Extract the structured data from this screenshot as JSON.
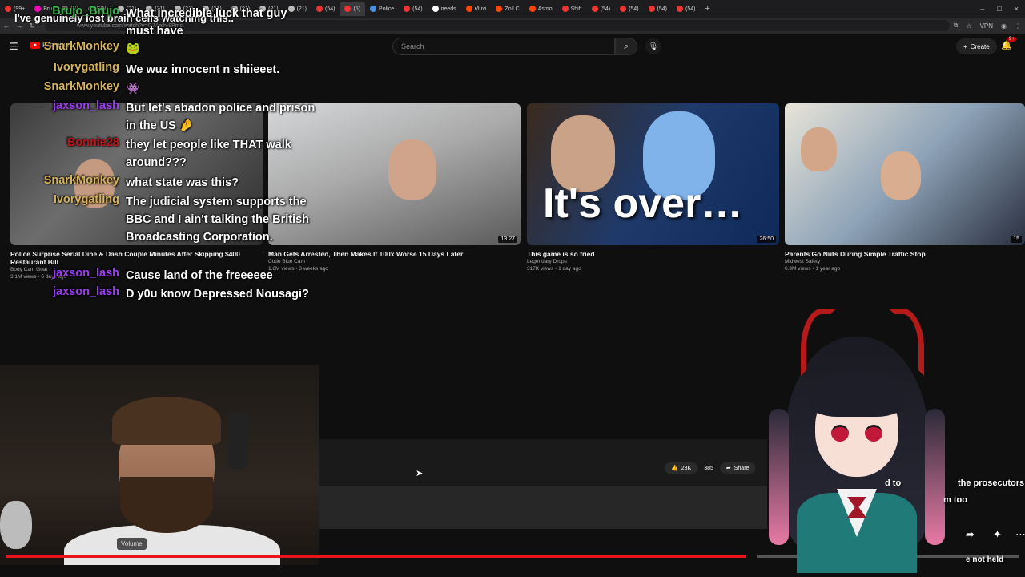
{
  "browser": {
    "tabs": [
      "(99+",
      "Bru",
      "(N)",
      "F(N)",
      "(21)",
      "(21)",
      "(21)",
      "(21)",
      "(21)",
      "(21)",
      "(21)",
      "(54)",
      "(5)",
      "Police",
      "(54)",
      "needs",
      "r/Livi",
      "Zoil C",
      "Asmo",
      "Shift",
      "(54)",
      "(54)",
      "(54)",
      "(54)"
    ],
    "url": "www.youtube.com/watch?v=G7Aalh-9Pmc",
    "vpn_label": "VPN"
  },
  "youtube": {
    "logo_text": "Premium",
    "search_placeholder": "Search",
    "create_label": "Create",
    "notif_count": "9+"
  },
  "videos": [
    {
      "title": "Police Surprise Serial Dine & Dash Couple Minutes After Skipping $400 Restaurant Bill",
      "channel": "Body Cam Goat",
      "meta": "3.1M views • 6 days ago",
      "duration": ""
    },
    {
      "title": "Man Gets Arrested, Then Makes It 100x Worse 15 Days Later",
      "channel": "Code Blue Cam",
      "meta": "1.6M views • 3 weeks ago",
      "duration": "13:27"
    },
    {
      "title": "This game is so fried",
      "channel": "Legendary Drops",
      "meta": "317K views • 1 day ago",
      "duration": "26:50",
      "overlay_text": "It's over…"
    },
    {
      "title": "Parents Go Nuts During Simple Traffic Stop",
      "channel": "Midwest Safety",
      "meta": "6.9M views • 1 year ago",
      "duration": "15"
    }
  ],
  "chat": [
    {
      "user": "",
      "msg": "I've genuinely lost brain cells watching this..",
      "color": "#ffffff"
    },
    {
      "user": "Brujo_Brujo",
      "msg": "What incredible luck that guy must have",
      "color": "#3cb44b"
    },
    {
      "user": "SnarkMonkey",
      "msg": "🐸",
      "color": "#d6b35c"
    },
    {
      "user": "Ivorygatling",
      "msg": "We wuz innocent n shiieeet.",
      "color": "#d6b35c"
    },
    {
      "user": "SnarkMonkey",
      "msg": "👾",
      "color": "#d6b35c"
    },
    {
      "user": "jaxson_lash",
      "msg": "But let's abadon police and prison in the US 🤌",
      "color": "#9b3cf0"
    },
    {
      "user": "Bonnie28",
      "msg": "they let people like THAT walk around???",
      "color": "#c0141b"
    },
    {
      "user": "SnarkMonkey",
      "msg": "what state was this?",
      "color": "#d6b35c"
    },
    {
      "user": "Ivorygatling",
      "msg": "The judicial system supports the BBC and I ain't talking the British Broadcasting Corporation.",
      "color": "#d6b35c"
    },
    {
      "user": "jaxson_lash",
      "msg": "Cause land of the freeeeee",
      "color": "#9b3cf0"
    },
    {
      "user": "jaxson_lash",
      "msg": "D y0u know Depressed Nousagi?",
      "color": "#9b3cf0"
    }
  ],
  "player": {
    "likes": "23K",
    "comments": "385",
    "share_label": "Share",
    "volume_tooltip": "Volume",
    "progress": 0.73
  },
  "right_overlay": {
    "line1": "the prosecutors",
    "line2": "m too",
    "line3": "d to",
    "line4": "e not held"
  }
}
